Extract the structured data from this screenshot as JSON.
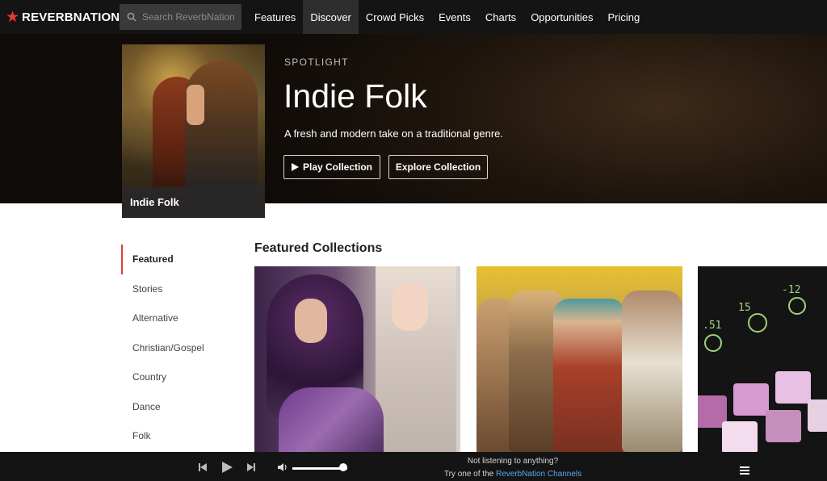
{
  "navbar": {
    "logo_text": "REVERBNATION",
    "logo_reg": "®",
    "search_placeholder": "Search ReverbNation",
    "items": [
      {
        "label": "Features",
        "active": false
      },
      {
        "label": "Discover",
        "active": true
      },
      {
        "label": "Crowd Picks",
        "active": false
      },
      {
        "label": "Events",
        "active": false
      },
      {
        "label": "Charts",
        "active": false
      },
      {
        "label": "Opportunities",
        "active": false
      },
      {
        "label": "Pricing",
        "active": false
      }
    ]
  },
  "hero": {
    "card_label": "Indie Folk",
    "spotlight_label": "SPOTLIGHT",
    "title": "Indie Folk",
    "description": "A fresh and modern take on a traditional genre.",
    "play_button": "Play Collection",
    "explore_button": "Explore Collection"
  },
  "sidebar": {
    "items": [
      {
        "label": "Featured",
        "active": true
      },
      {
        "label": "Stories",
        "active": false
      },
      {
        "label": "Alternative",
        "active": false
      },
      {
        "label": "Christian/Gospel",
        "active": false
      },
      {
        "label": "Country",
        "active": false
      },
      {
        "label": "Dance",
        "active": false
      },
      {
        "label": "Folk",
        "active": false
      }
    ]
  },
  "featured": {
    "heading": "Featured Collections"
  },
  "player": {
    "volume_level": 0.92,
    "message_line1": "Not listening to anything?",
    "message_line2_prefix": "Try one of the",
    "message_link": "ReverbNation Channels"
  },
  "colors": {
    "brand_red": "#e43d32",
    "link_blue": "#5aa7e8",
    "nav_bg": "#141414"
  }
}
